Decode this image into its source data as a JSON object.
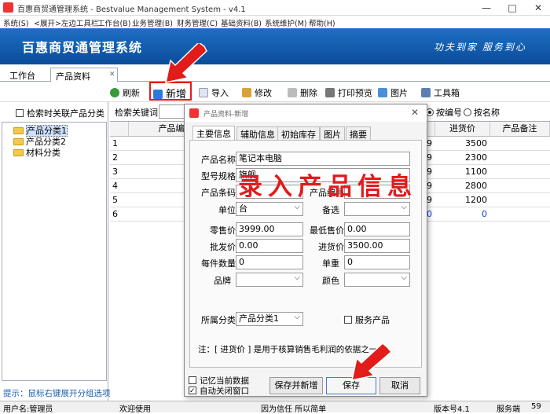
{
  "window": {
    "title": "百惠商贸通管理系统 - Bestvalue Management System - v4.1",
    "min": "—",
    "max": "□",
    "close": "✕"
  },
  "menu": [
    "系统(S)",
    "<展开>左边工具栏",
    "工作台(B)",
    "业务管理(B)",
    "财务管理(C)",
    "基础资料(B)",
    "系统维护(M)",
    "帮助(H)"
  ],
  "banner": {
    "name": "百惠商贸通管理系统",
    "slogan": "功夫到家 服务到心"
  },
  "tabs": [
    "工作台",
    "产品资料"
  ],
  "tab_close": "✕",
  "toolbar": {
    "refresh": "刷新",
    "add": "新增",
    "import": "导入",
    "edit": "修改",
    "delete": "删除",
    "print": "打印预览",
    "picture": "图片",
    "toolbox": "工具箱"
  },
  "left": {
    "search_related": "检索时关联产品分类",
    "tree": [
      "产品分类1",
      "产品分类2",
      "材料分类"
    ],
    "hint": "提示：鼠标右键展开分组选项"
  },
  "search": {
    "label": "检索关键词",
    "radio_code": "按编号",
    "radio_name": "按名称"
  },
  "grid": {
    "headers": [
      "产品编号",
      "进货价",
      "产品备注"
    ],
    "rows": [
      {
        "n": "1",
        "a": "99",
        "b": "3500"
      },
      {
        "n": "2",
        "a": "99",
        "b": "2300"
      },
      {
        "n": "3",
        "a": "99",
        "b": "1100"
      },
      {
        "n": "4",
        "a": "99",
        "b": "2800"
      },
      {
        "n": "5",
        "a": "99",
        "b": "1200"
      },
      {
        "n": "6",
        "a": "00",
        "b": "0"
      }
    ]
  },
  "dialog": {
    "title": "产品资料-新增",
    "close": "✕",
    "tabs": [
      "主要信息",
      "辅助信息",
      "初始库存",
      "图片",
      "摘要"
    ],
    "fields": {
      "name_label": "产品名称",
      "name_value": "笔记本电脑",
      "model_label": "型号规格",
      "model_value": "旗舰",
      "barcode_label": "产品条码",
      "code_label": "产品编号",
      "unit_label": "单位",
      "unit_value": "台",
      "alt_label": "备选",
      "retail_label": "零售价",
      "retail_value": "3999.00",
      "minprice_label": "最低售价",
      "minprice_value": "0.00",
      "wholesale_label": "批发价",
      "wholesale_value": "0.00",
      "purchase_label": "进货价",
      "purchase_value": "3500.00",
      "pack_label": "每件数量",
      "pack_value": "0",
      "weight_label": "单重",
      "weight_value": "0",
      "brand_label": "品牌",
      "color_label": "颜色",
      "category_label": "所属分类",
      "category_value": "产品分类1",
      "service_label": "服务产品"
    },
    "note": "注：[ 进货价 ] 是用于核算销售毛利润的依据之一；",
    "remember": "记忆当前数据",
    "autoclose": "自动关闭窗口",
    "btn_save_new": "保存并新增",
    "btn_save": "保存",
    "btn_cancel": "取消"
  },
  "overlay_text": "录入产品信息",
  "status": {
    "user": "用户名:管理员",
    "welcome": "欢迎使用",
    "motto": "因为信任 所以简单",
    "version": "版本号4.1",
    "side": "服务端",
    "extra": "59"
  },
  "colors": {
    "banner": "#0b4c9a",
    "annotation_red": "#e21b1b",
    "hint_blue": "#1a5fb4"
  }
}
